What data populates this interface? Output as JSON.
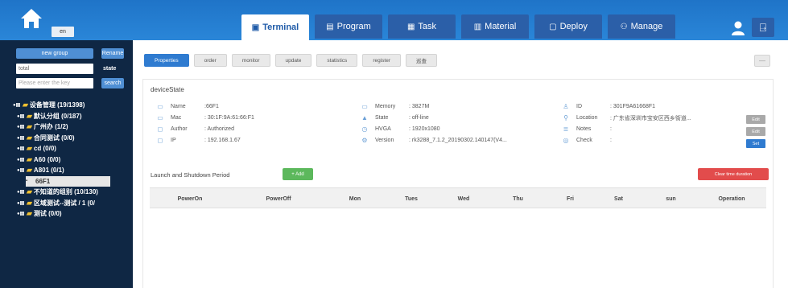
{
  "header": {
    "system_label": "en",
    "nav_tabs": [
      {
        "label": "Terminal",
        "icon": "monitor-icon",
        "active": true
      },
      {
        "label": "Program",
        "icon": "program-icon",
        "active": false
      },
      {
        "label": "Task",
        "icon": "task-icon",
        "active": false
      },
      {
        "label": "Material",
        "icon": "material-icon",
        "active": false
      },
      {
        "label": "Deploy",
        "icon": "deploy-icon",
        "active": false
      },
      {
        "label": "Manage",
        "icon": "manage-icon",
        "active": false
      }
    ]
  },
  "sidebar": {
    "new_group_button": "new group",
    "rename_button": "Rename",
    "filter_select": "total",
    "state_label": "state",
    "search_placeholder": "Please enter the key",
    "search_button": "search",
    "tree": [
      {
        "label": "设备管理 (19/1398)",
        "level": 0
      },
      {
        "label": "默认分组 (0/187)",
        "level": 1
      },
      {
        "label": "广州办 (1/2)",
        "level": 1
      },
      {
        "label": "合同测试 (0/0)",
        "level": 1
      },
      {
        "label": "cd (0/0)",
        "level": 1
      },
      {
        "label": "A60 (0/0)",
        "level": 1
      },
      {
        "label": "A801 (0/1)",
        "level": 1
      },
      {
        "label": "66F1",
        "level": 2,
        "selected": true
      },
      {
        "label": "不知道的组别 (10/130)",
        "level": 1
      },
      {
        "label": "区域测试--测试 / 1 (0/",
        "level": 1
      },
      {
        "label": "测试 (0/0)",
        "level": 1
      }
    ]
  },
  "main": {
    "subtabs": [
      "Properties",
      "order",
      "monitor",
      "update",
      "statistics",
      "register",
      "巡查"
    ],
    "device_state_title": "deviceState",
    "info": {
      "name_label": "Name",
      "name_value": ":66F1",
      "mac_label": "Mac",
      "mac_value": ": 30:1F:9A:61:66:F1",
      "author_label": "Author",
      "author_value": ": Authorized",
      "ip_label": "IP",
      "ip_value": ": 192.168.1.67",
      "memory_label": "Memory",
      "memory_value": ": 3827M",
      "state_label": "State",
      "state_value": ": off-line",
      "hvga_label": "HVGA",
      "hvga_value": ": 1920x1080",
      "version_label": "Version",
      "version_value": ": rk3288_7.1.2_20190302.140147(V4...",
      "id_label": "ID",
      "id_value": ": 301F9A61668F1",
      "location_label": "Location",
      "location_value": ": 广东省深圳市宝安区西乡街道...",
      "notes_label": "Notes",
      "notes_value": ":",
      "check_label": "Check",
      "check_value": ":"
    },
    "edit_buttons": [
      "Edit",
      "Edit",
      "Set"
    ],
    "period_title": "Launch and Shutdown Period",
    "add_button": "+ Add",
    "clear_button": "Clear time duration",
    "columns": [
      "PowerOn",
      "PowerOff",
      "Mon",
      "Tues",
      "Wed",
      "Thu",
      "Fri",
      "Sat",
      "sun",
      "Operation"
    ]
  }
}
